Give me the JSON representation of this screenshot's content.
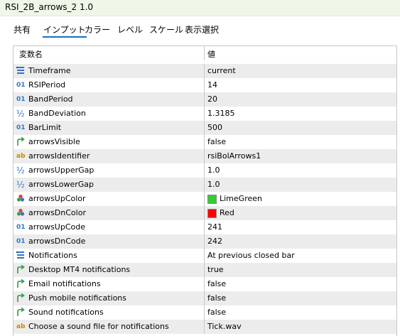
{
  "window": {
    "title": "RSI_2B_arrows_2 1.0"
  },
  "tabs": [
    {
      "label": "共有",
      "active": false
    },
    {
      "label": "インプット",
      "active": true
    },
    {
      "label": "カラー",
      "active": false
    },
    {
      "label": "レベル",
      "active": false
    },
    {
      "label": "スケール",
      "active": false
    },
    {
      "label": "表示選択",
      "active": false
    }
  ],
  "table": {
    "headers": {
      "name": "変数名",
      "value": "値"
    },
    "rows": [
      {
        "icon": "enum",
        "name": "Timeframe",
        "value": "current"
      },
      {
        "icon": "int",
        "name": "RSIPeriod",
        "value": "14"
      },
      {
        "icon": "int",
        "name": "BandPeriod",
        "value": "20"
      },
      {
        "icon": "double",
        "name": "BandDeviation",
        "value": "1.3185"
      },
      {
        "icon": "int",
        "name": "BarLimit",
        "value": "500"
      },
      {
        "icon": "bool",
        "name": "arrowsVisible",
        "value": "false"
      },
      {
        "icon": "string",
        "name": "arrowsIdentifier",
        "value": "rsiBolArrows1"
      },
      {
        "icon": "double",
        "name": "arrowsUpperGap",
        "value": "1.0"
      },
      {
        "icon": "double",
        "name": "arrowsLowerGap",
        "value": "1.0"
      },
      {
        "icon": "color",
        "name": "arrowsUpColor",
        "value": "LimeGreen",
        "swatch": "#32cd32"
      },
      {
        "icon": "color",
        "name": "arrowsDnColor",
        "value": "Red",
        "swatch": "#ff0000"
      },
      {
        "icon": "int",
        "name": "arrowsUpCode",
        "value": "241"
      },
      {
        "icon": "int",
        "name": "arrowsDnCode",
        "value": "242"
      },
      {
        "icon": "enum",
        "name": "Notifications",
        "value": "At previous closed bar"
      },
      {
        "icon": "bool",
        "name": "Desktop MT4 notifications",
        "value": "true"
      },
      {
        "icon": "bool",
        "name": "Email notifications",
        "value": "false"
      },
      {
        "icon": "bool",
        "name": "Push mobile notifications",
        "value": "false"
      },
      {
        "icon": "bool",
        "name": "Sound notifications",
        "value": "false"
      },
      {
        "icon": "string",
        "name": "Choose a sound file for notifications",
        "value": "Tick.wav"
      }
    ]
  },
  "icon_glyphs": {
    "int": "01",
    "double": "½",
    "string": "ab"
  },
  "colors": {
    "accent": "#1a6fc4",
    "int_icon": "#2f76c8",
    "bool_icon": "#2e9b3f",
    "string_icon": "#c68a00",
    "row_alt": "#ececec"
  }
}
